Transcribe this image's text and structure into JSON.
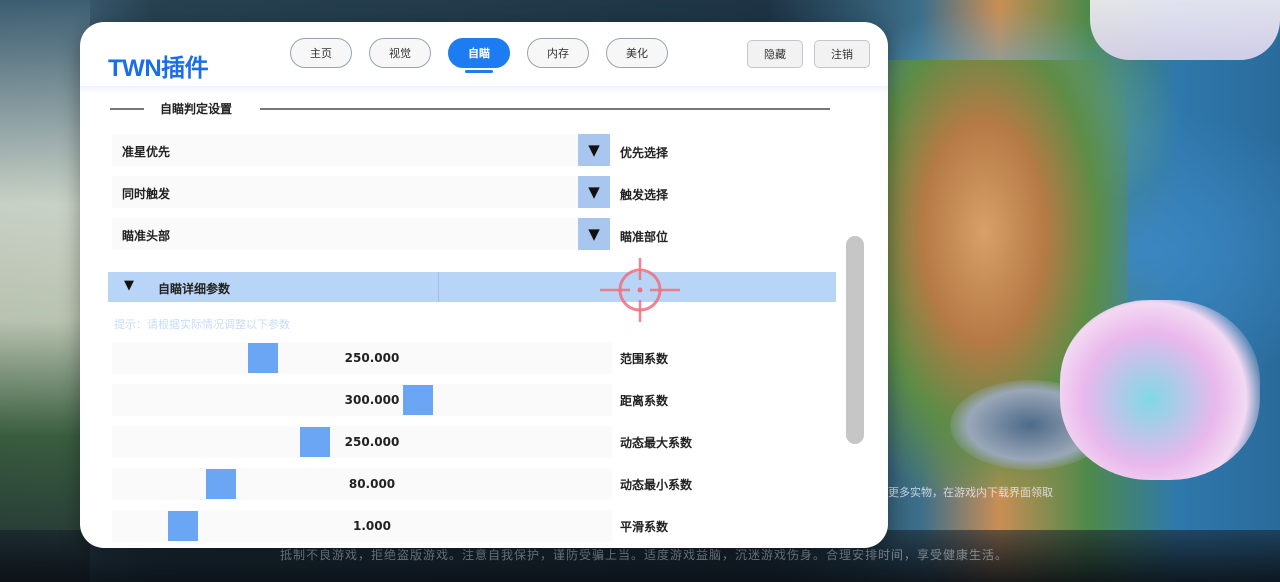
{
  "background": {
    "footer_note": "抵制不良游戏，拒绝盗版游戏。注意自我保护，谨防受骗上当。适度游戏益脑，沉迷游戏伤身。合理安排时间，享受健康生活。",
    "island_note": "更多实物，在游戏内下载界面领取"
  },
  "header": {
    "brand": "TWN插件",
    "tabs": [
      {
        "label": "主页",
        "active": false
      },
      {
        "label": "视觉",
        "active": false
      },
      {
        "label": "自瞄",
        "active": true
      },
      {
        "label": "内存",
        "active": false
      },
      {
        "label": "美化",
        "active": false
      }
    ],
    "buttons": {
      "hide": "隐藏",
      "exit": "注销"
    }
  },
  "aim_section": {
    "title": "自瞄判定设置",
    "selects": [
      {
        "value": "准星优先",
        "label": "优先选择"
      },
      {
        "value": "同时触发",
        "label": "触发选择"
      },
      {
        "value": "瞄准头部",
        "label": "瞄准部位"
      }
    ]
  },
  "detail_section": {
    "title": "自瞄详细参数",
    "expanded": true,
    "hint": "提示：请根据实际情况调整以下参数",
    "sliders": [
      {
        "value": "250.000",
        "label": "范围系数",
        "fraction": 0.29
      },
      {
        "value": "300.000",
        "label": "距离系数",
        "fraction": 0.62
      },
      {
        "value": "250.000",
        "label": "动态最大系数",
        "fraction": 0.4
      },
      {
        "value": "80.000",
        "label": "动态最小系数",
        "fraction": 0.2
      },
      {
        "value": "1.000",
        "label": "平滑系数",
        "fraction": 0.12
      }
    ]
  },
  "colors": {
    "accent": "#1d7cf2",
    "thumb": "#6aa6f4",
    "collapse_bar": "#b8d5f7"
  },
  "icons": {
    "dropdown": "triangle-down-icon",
    "crosshair": "crosshair-icon"
  }
}
